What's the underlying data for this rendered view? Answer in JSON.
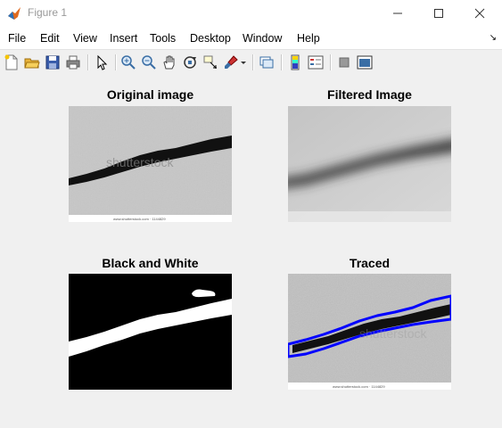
{
  "window": {
    "title": "Figure 1"
  },
  "menu": {
    "file": "File",
    "edit": "Edit",
    "view": "View",
    "insert": "Insert",
    "tools": "Tools",
    "desktop": "Desktop",
    "window": "Window",
    "help": "Help"
  },
  "toolbar": {
    "icons": [
      "new-figure-icon",
      "open-file-icon",
      "save-icon",
      "print-icon",
      "select-arrow-icon",
      "zoom-in-icon",
      "zoom-out-icon",
      "pan-hand-icon",
      "rotate-3d-icon",
      "data-cursor-icon",
      "brush-icon",
      "link-plot-icon",
      "insert-colorbar-icon",
      "insert-legend-icon",
      "hide-plot-tools-icon",
      "show-plot-tools-icon"
    ]
  },
  "axes": {
    "original_title": "Original image",
    "filtered_title": "Filtered Image",
    "bw_title": "Black and White",
    "traced_title": "Traced"
  },
  "watermark": {
    "text": "shutterstock",
    "caption": "www.shutterstock.com · 1144829"
  },
  "colors": {
    "trace": "#0000ff",
    "figure_bg": "#f0f0f0"
  }
}
